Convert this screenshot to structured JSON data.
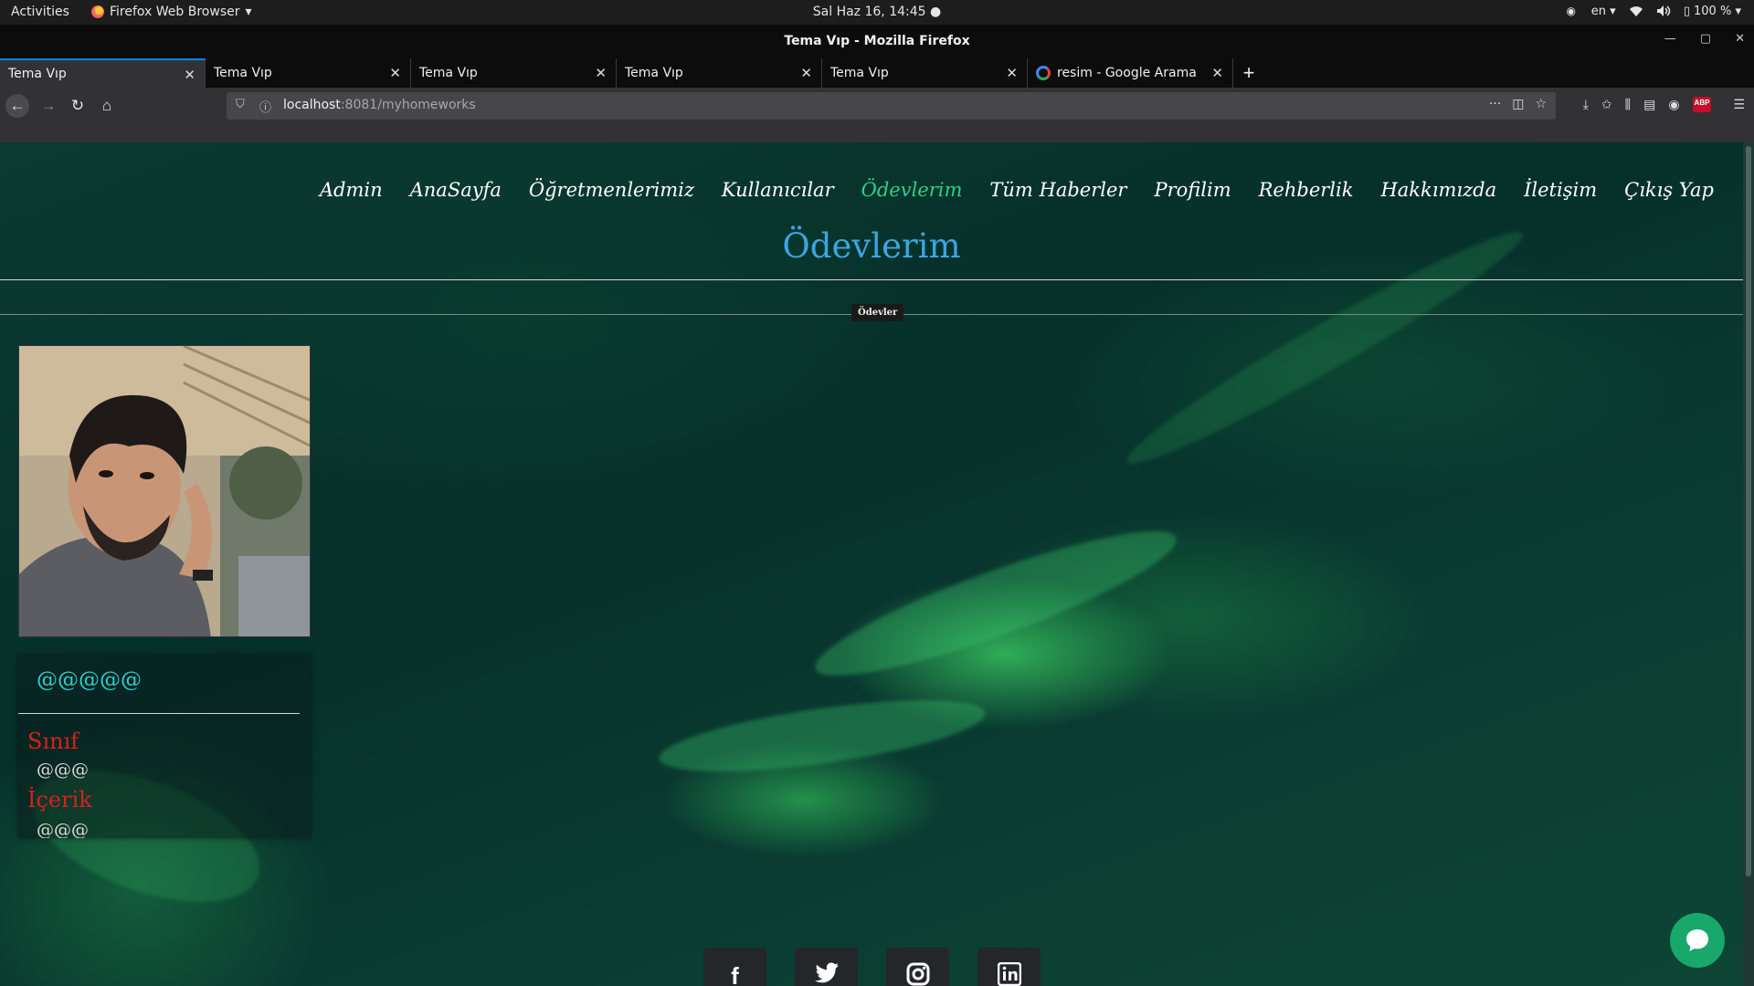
{
  "os_bar": {
    "activities": "Activities",
    "app_menu": "Firefox Web Browser",
    "clock": "Sal Haz 16, 14:45",
    "lang": "en",
    "battery": "100 %"
  },
  "window": {
    "title": "Tema Vıp - Mozilla Firefox"
  },
  "tabs": [
    {
      "label": "Tema Vıp",
      "active": true
    },
    {
      "label": "Tema Vıp",
      "active": false
    },
    {
      "label": "Tema Vıp",
      "active": false
    },
    {
      "label": "Tema Vıp",
      "active": false
    },
    {
      "label": "Tema Vıp",
      "active": false
    },
    {
      "label": "resim - Google Arama",
      "active": false
    }
  ],
  "urlbar": {
    "host": "localhost",
    "path": ":8081/myhomeworks"
  },
  "site": {
    "nav": [
      "Admin",
      "AnaSayfa",
      "Öğretmenlerimiz",
      "Kullanıcılar",
      "Ödevlerim",
      "Tüm Haberler",
      "Profilim",
      "Rehberlik",
      "Hakkımızda",
      "İletişim",
      "Çıkış Yap"
    ],
    "active_nav": "Ödevlerim",
    "page_title": "Ödevlerim",
    "section_badge": "Ödevler",
    "card": {
      "name": "@@@@@",
      "class_label": "Sınıf",
      "class_value": "@@@",
      "content_label": "İçerik",
      "content_value": "@@@"
    },
    "socials": [
      "facebook-icon",
      "twitter-icon",
      "instagram-icon",
      "linkedin-icon"
    ]
  },
  "colors": {
    "accent_nav_active": "#2fd08a",
    "page_title": "#3aa6e0",
    "card_name": "#2ed0d0",
    "card_label": "#d91f1f",
    "chat_button": "#18a86b"
  }
}
